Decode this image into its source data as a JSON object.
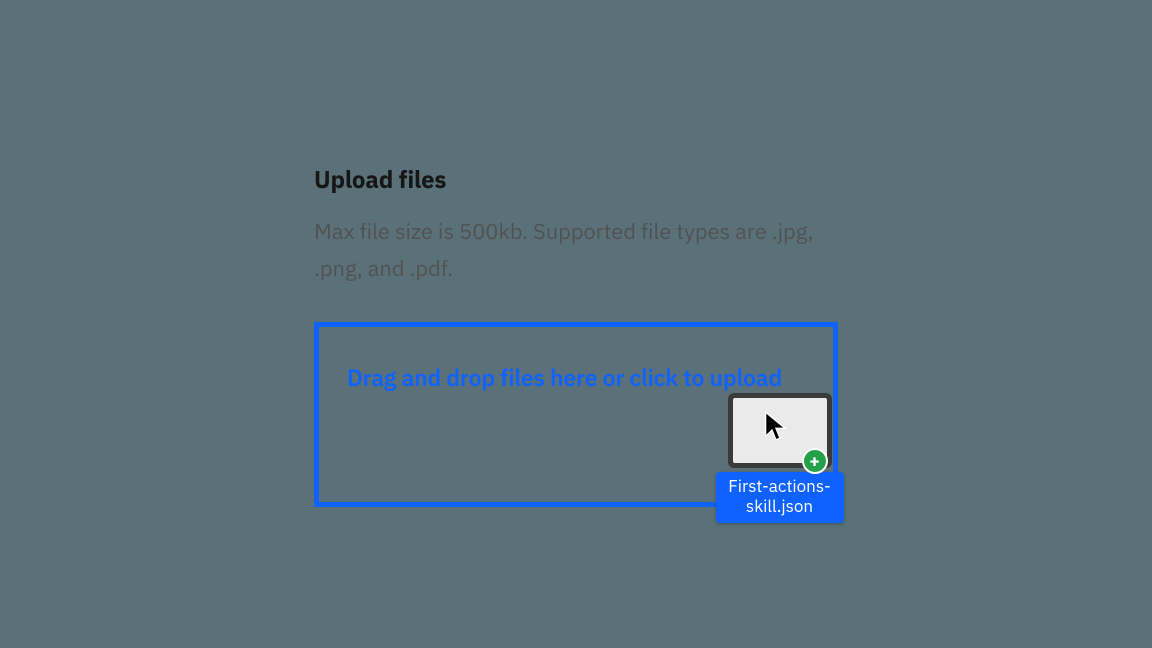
{
  "uploader": {
    "title": "Upload files",
    "description": "Max file size is 500kb. Supported file types are .jpg, .png, and .pdf.",
    "dropzone_text": "Drag and drop files here or click to upload"
  },
  "drag": {
    "filename": "First-actions-skill.json"
  },
  "colors": {
    "accent": "#0f62fe",
    "success": "#24a148"
  }
}
